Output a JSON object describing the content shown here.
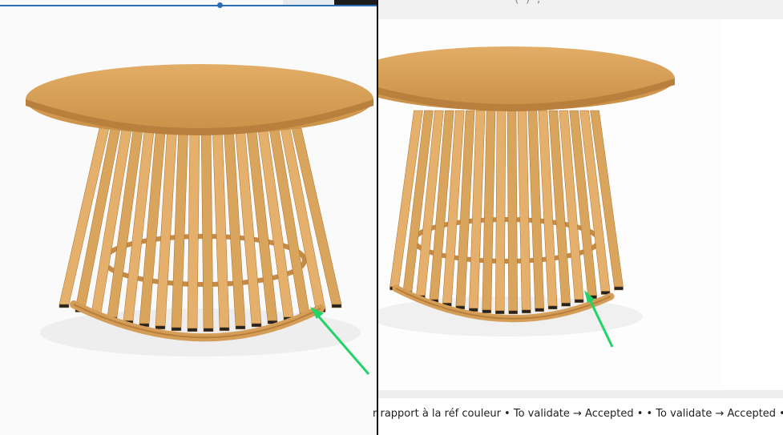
{
  "left_image": {
    "subject": "round wooden coffee table with slatted base",
    "annotation": "green-arrow-icon"
  },
  "right_image": {
    "subject": "round wooden coffee table with slatted base",
    "annotation": "green-arrow-icon",
    "header_fragment": "( ) ;"
  },
  "footer": {
    "text": "r rapport à la réf couleur • To validate → Accepted • • To validate → Accepted •"
  },
  "colors": {
    "accent_blue": "#2a6fb5",
    "arrow_green": "#22d36a",
    "wood": "#d9a45c",
    "wood_dark": "#b87f3a"
  }
}
